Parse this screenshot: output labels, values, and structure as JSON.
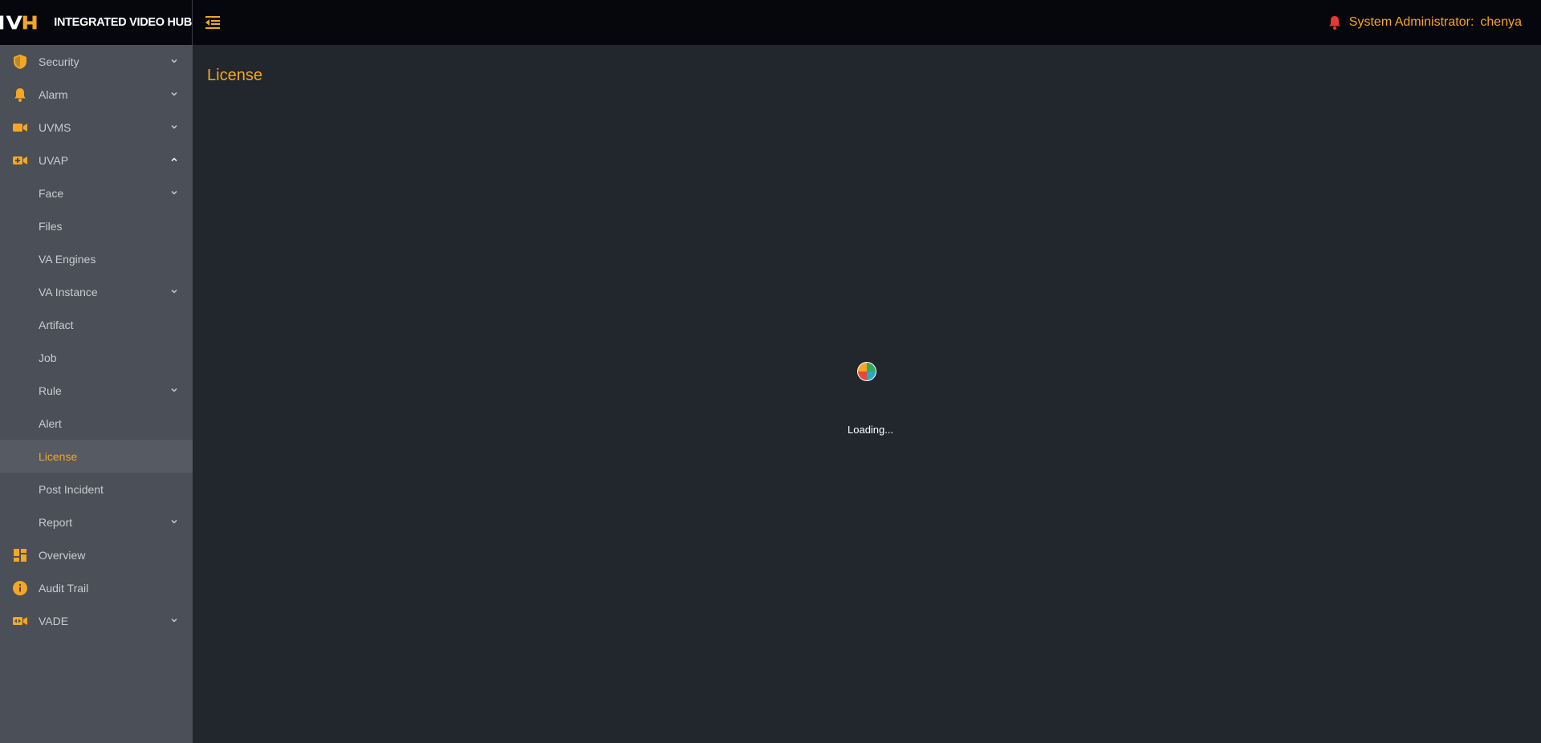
{
  "app": {
    "logo_text": "IVH",
    "title": "INTEGRATED VIDEO HUB"
  },
  "header": {
    "role_label": "System Administrator:",
    "username": "chenya"
  },
  "sidebar": {
    "items": [
      {
        "label": "Security",
        "icon": "shield-icon"
      },
      {
        "label": "Alarm",
        "icon": "bell-icon"
      },
      {
        "label": "UVMS",
        "icon": "video-camera-icon"
      },
      {
        "label": "UVAP",
        "icon": "video-add-icon"
      },
      {
        "label": "Face"
      },
      {
        "label": "Files"
      },
      {
        "label": "VA Engines"
      },
      {
        "label": "VA Instance"
      },
      {
        "label": "Artifact"
      },
      {
        "label": "Job"
      },
      {
        "label": "Rule"
      },
      {
        "label": "Alert"
      },
      {
        "label": "License"
      },
      {
        "label": "Post Incident"
      },
      {
        "label": "Report"
      },
      {
        "label": "Overview",
        "icon": "dashboard-icon"
      },
      {
        "label": "Audit Trail",
        "icon": "info-icon"
      },
      {
        "label": "VADE",
        "icon": "video-arrows-icon"
      }
    ]
  },
  "main": {
    "page_title": "License",
    "loading_text": "Loading..."
  },
  "colors": {
    "accent": "#f6a623",
    "topbar_bg": "#05070c",
    "sidebar_bg": "#4a4f58",
    "main_bg": "#22272e",
    "alert_red": "#e53935"
  }
}
